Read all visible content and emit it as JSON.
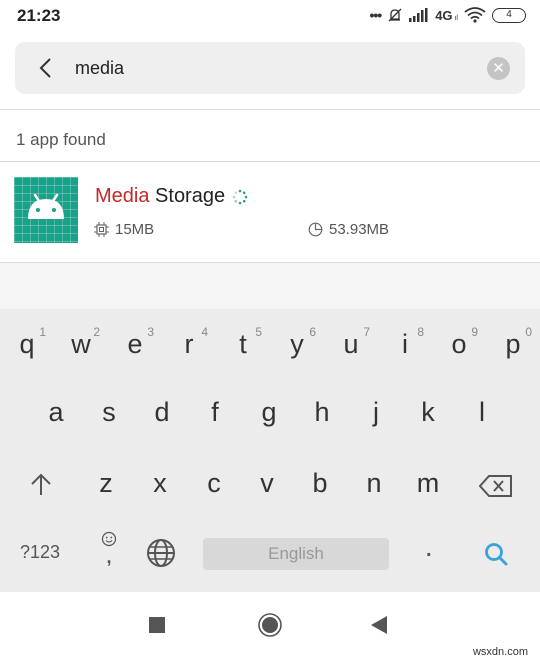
{
  "status_bar": {
    "time": "21:23",
    "network": "4G",
    "network_sub": "..ll",
    "battery": "4",
    "icons": [
      "more-dots-icon",
      "bell-muted-icon",
      "signal-icon",
      "network-4g-icon",
      "wifi-icon",
      "battery-icon"
    ]
  },
  "search": {
    "value": "media",
    "back_icon": "chevron-left-icon",
    "clear_icon": "clear-icon"
  },
  "results": {
    "count_label": "1 app found",
    "apps": [
      {
        "name_highlight": "Media",
        "name_rest": " Storage",
        "memory": "15MB",
        "storage": "53.93MB",
        "icon": "android-app-icon",
        "status_icon": "loading-spinner-icon"
      }
    ]
  },
  "keyboard": {
    "row1": [
      {
        "key": "q",
        "num": "1"
      },
      {
        "key": "w",
        "num": "2"
      },
      {
        "key": "e",
        "num": "3"
      },
      {
        "key": "r",
        "num": "4"
      },
      {
        "key": "t",
        "num": "5"
      },
      {
        "key": "y",
        "num": "6"
      },
      {
        "key": "u",
        "num": "7"
      },
      {
        "key": "i",
        "num": "8"
      },
      {
        "key": "o",
        "num": "9"
      },
      {
        "key": "p",
        "num": "0"
      }
    ],
    "row2": [
      "a",
      "s",
      "d",
      "f",
      "g",
      "h",
      "j",
      "k",
      "l"
    ],
    "row3": [
      "z",
      "x",
      "c",
      "v",
      "b",
      "n",
      "m"
    ],
    "symbols_label": "?123",
    "comma": ",",
    "space_label": "English",
    "period": ".",
    "accent_color": "#3aa3d8"
  },
  "navbar": {
    "buttons": [
      "recents-icon",
      "home-icon",
      "back-icon"
    ]
  },
  "watermark": "wsxdn.com"
}
